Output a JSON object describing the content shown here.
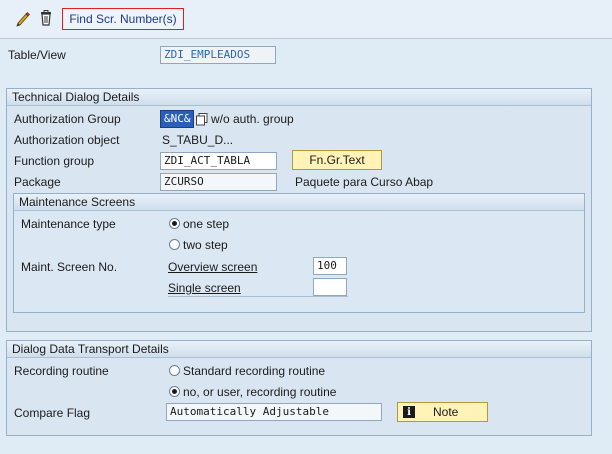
{
  "toolbar": {
    "edit_icon": "pencil-icon",
    "delete_icon": "trash-icon",
    "find_button_label": "Find Scr. Number(s)"
  },
  "header": {
    "table_view_label": "Table/View",
    "table_view_value": "ZDI_EMPLEADOS"
  },
  "technical": {
    "title": "Technical Dialog Details",
    "auth_group_label": "Authorization Group",
    "auth_group_value": "&NC&",
    "auth_group_desc": "w/o auth. group",
    "auth_object_label": "Authorization object",
    "auth_object_value": "S_TABU_D...",
    "function_group_label": "Function group",
    "function_group_value": "ZDI_ACT_TABLA",
    "fn_gr_text_button": "Fn.Gr.Text",
    "package_label": "Package",
    "package_value": "ZCURSO",
    "package_desc": "Paquete para Curso Abap"
  },
  "maintenance": {
    "title": "Maintenance Screens",
    "type_label": "Maintenance type",
    "one_step": "one step",
    "two_step": "two step",
    "selected": "one_step",
    "screen_no_label": "Maint. Screen No.",
    "overview_label": "Overview screen",
    "overview_value": "100",
    "single_label": "Single screen",
    "single_value": ""
  },
  "transport": {
    "title": "Dialog Data Transport Details",
    "recording_label": "Recording routine",
    "standard_option": "Standard recording routine",
    "no_user_option": "no, or user, recording routine",
    "selected": "no_user",
    "compare_label": "Compare Flag",
    "compare_value": "Automatically Adjustable",
    "note_button": "Note",
    "note_icon": "info-icon"
  },
  "colors": {
    "background": "#dfebf5",
    "highlight_field": "#2a5fb5",
    "button_yellow": "#fff3b8",
    "find_button_border": "#e02020"
  }
}
